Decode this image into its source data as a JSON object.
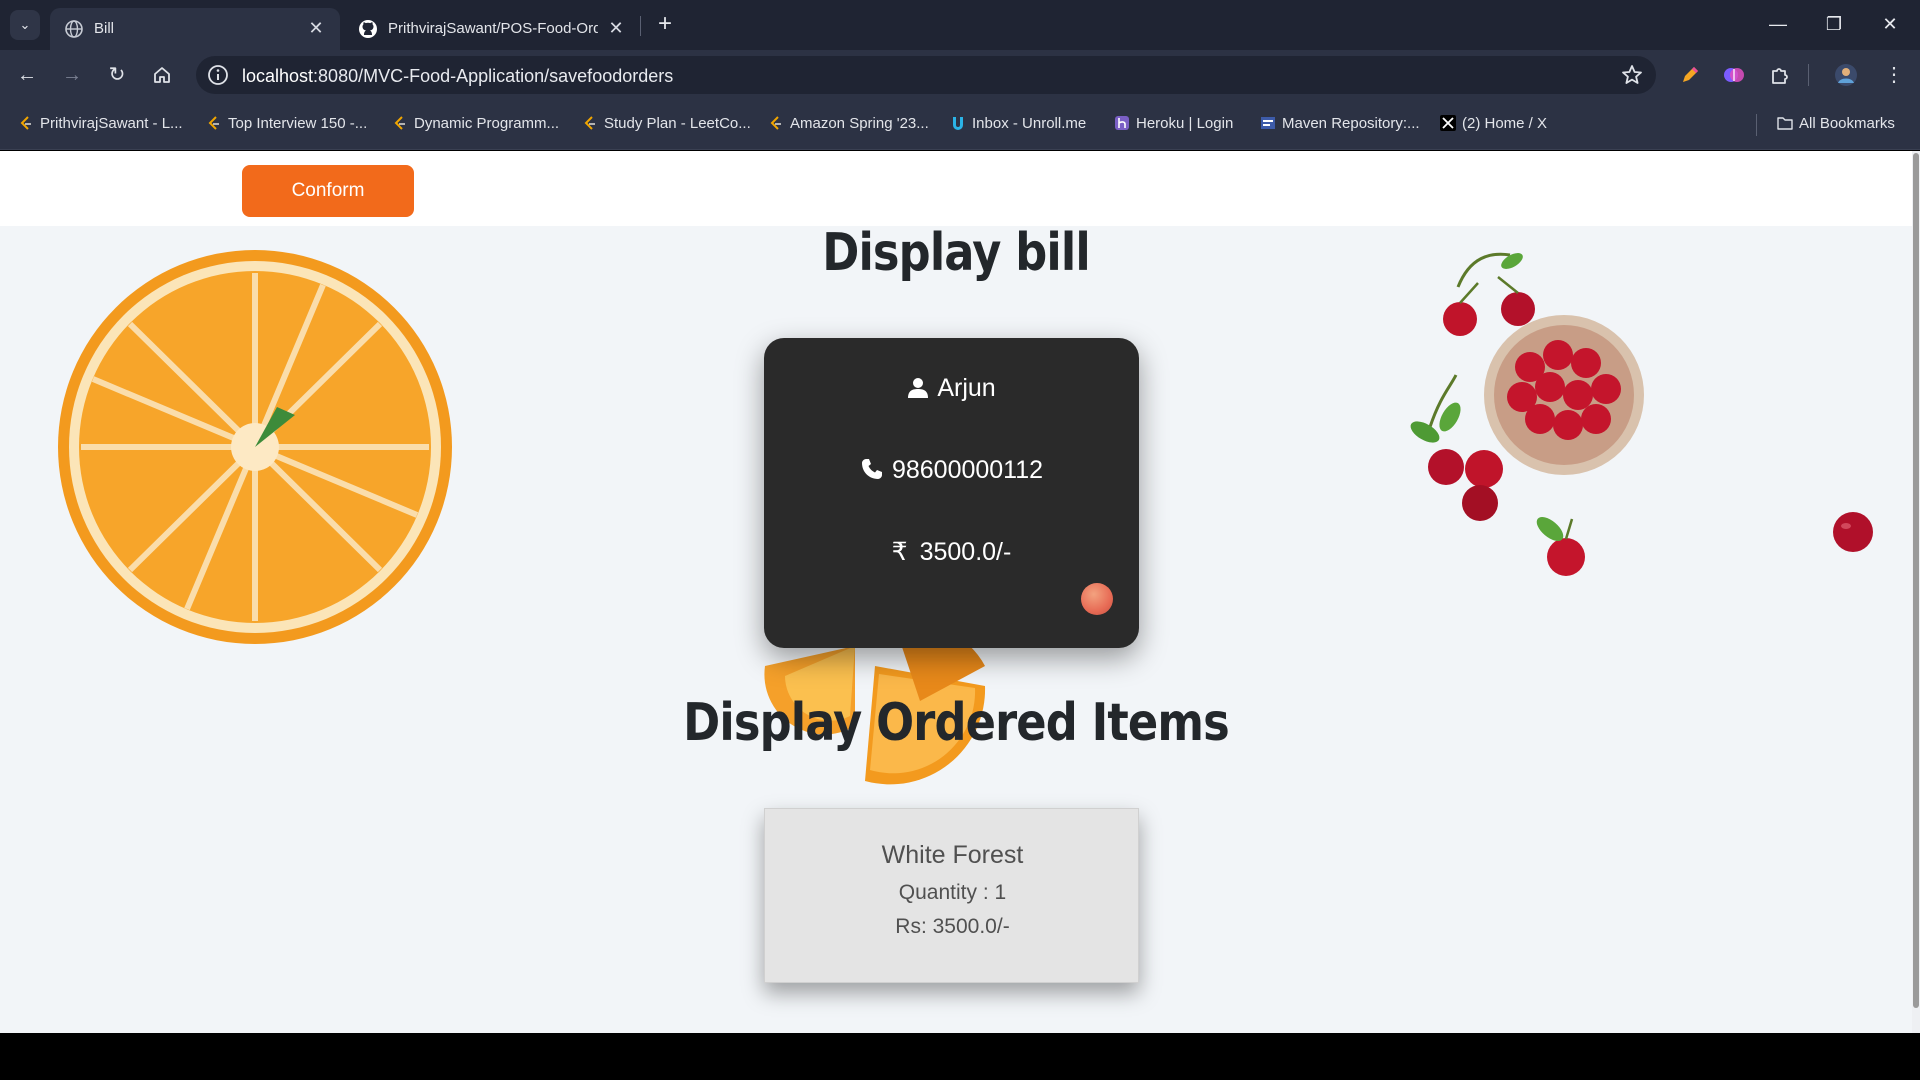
{
  "browser": {
    "tabs": [
      {
        "title": "Bill",
        "active": true
      },
      {
        "title": "PrithvirajSawant/POS-Food-Ord",
        "active": false
      }
    ],
    "address": {
      "host": "localhost",
      "path": ":8080/MVC-Food-Application/savefoodorders"
    },
    "bookmarks": [
      {
        "label": "PrithvirajSawant - L...",
        "icon": "leetcode-icon"
      },
      {
        "label": "Top Interview 150 -...",
        "icon": "leetcode-icon"
      },
      {
        "label": "Dynamic Programm...",
        "icon": "leetcode-icon"
      },
      {
        "label": "Study Plan - LeetCo...",
        "icon": "leetcode-icon"
      },
      {
        "label": "Amazon Spring '23...",
        "icon": "leetcode-icon"
      },
      {
        "label": "Inbox - Unroll.me",
        "icon": "unroll-icon"
      },
      {
        "label": "Heroku | Login",
        "icon": "heroku-icon"
      },
      {
        "label": "Maven Repository:...",
        "icon": "maven-icon"
      },
      {
        "label": "(2) Home / X",
        "icon": "x-icon"
      }
    ],
    "all_bookmarks": "All Bookmarks"
  },
  "page": {
    "conform_label": "Conform",
    "bill_heading": "Display bill",
    "customer": {
      "name": "Arjun",
      "phone": "98600000112",
      "currency_symbol": "₹",
      "amount": "3500.0/-"
    },
    "items_heading": "Display Ordered Items",
    "items": [
      {
        "name": "White Forest",
        "quantity": "Quantity : 1",
        "price": "Rs: 3500.0/-"
      }
    ]
  },
  "colors": {
    "accent": "#f26a1b",
    "card_dark": "#2a2a2a",
    "page_bg": "#f2f5f8"
  }
}
